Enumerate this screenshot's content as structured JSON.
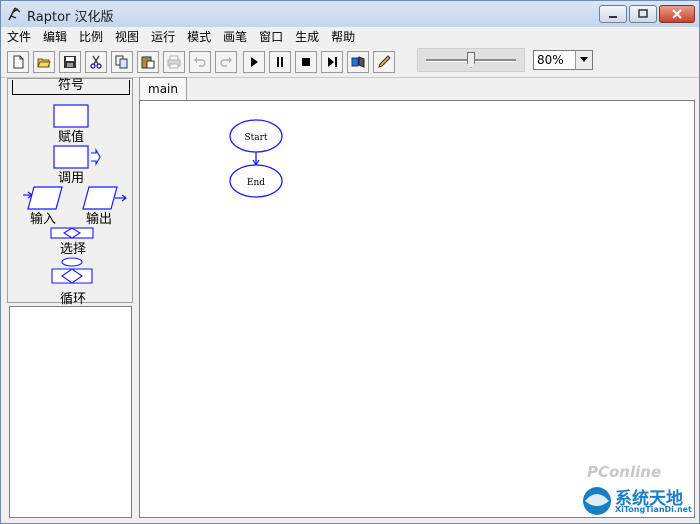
{
  "window": {
    "title": "Raptor 汉化版"
  },
  "menu": [
    "文件",
    "编辑",
    "比例",
    "视图",
    "运行",
    "模式",
    "画笔",
    "窗口",
    "生成",
    "帮助"
  ],
  "toolbar": {
    "buttons": [
      "new-file-icon",
      "open-folder-icon",
      "save-icon",
      "cut-icon",
      "copy-icon",
      "paste-icon",
      "print-icon",
      "undo-icon",
      "redo-icon",
      "play-icon",
      "pause-icon",
      "stop-icon",
      "step-icon",
      "compile-icon",
      "pen-icon"
    ],
    "disabled": [
      "print-icon",
      "undo-icon",
      "redo-icon"
    ],
    "speed_slider": {
      "value": 0.5
    },
    "zoom": {
      "value": "80%"
    }
  },
  "symbols": {
    "header": "符号",
    "items": [
      "赋值",
      "调用",
      "输入",
      "输出",
      "选择",
      "循环"
    ]
  },
  "tabs": [
    {
      "label": "main"
    }
  ],
  "flowchart": {
    "start_label": "Start",
    "end_label": "End"
  },
  "watermark": {
    "brand": "PConline",
    "title": "系统天地",
    "url": "XiTongTianDi.net"
  },
  "colors": {
    "flow_blue": "#1a1aff",
    "title_bar": "#c5d6ec",
    "watermark_blue": "#1a7ec6"
  }
}
